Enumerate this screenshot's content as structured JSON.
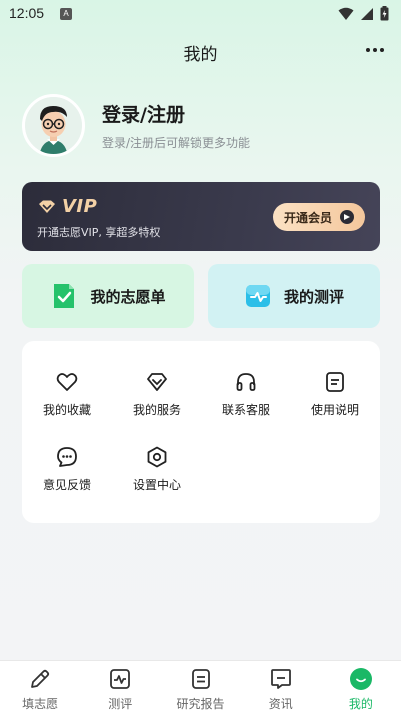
{
  "status_bar": {
    "time": "12:05",
    "notification_letter": "A"
  },
  "header": {
    "title": "我的"
  },
  "profile": {
    "title": "登录/注册",
    "subtitle": "登录/注册后可解锁更多功能"
  },
  "vip": {
    "badge": "VIP",
    "description": "开通志愿VIP, 享超多特权",
    "button_label": "开通会员"
  },
  "quick_actions": [
    {
      "label": "我的志愿单",
      "icon": "checklist-icon"
    },
    {
      "label": "我的测评",
      "icon": "assessment-icon"
    }
  ],
  "tools": [
    {
      "label": "我的收藏",
      "icon": "heart-icon"
    },
    {
      "label": "我的服务",
      "icon": "diamond-icon"
    },
    {
      "label": "联系客服",
      "icon": "headset-icon"
    },
    {
      "label": "使用说明",
      "icon": "document-icon"
    },
    {
      "label": "意见反馈",
      "icon": "feedback-icon"
    },
    {
      "label": "设置中心",
      "icon": "settings-icon"
    }
  ],
  "bottom_nav": [
    {
      "label": "填志愿",
      "icon": "pen-icon"
    },
    {
      "label": "测评",
      "icon": "chart-icon"
    },
    {
      "label": "研究报告",
      "icon": "report-icon"
    },
    {
      "label": "资讯",
      "icon": "news-icon"
    },
    {
      "label": "我的",
      "icon": "profile-icon",
      "active": true
    }
  ],
  "colors": {
    "accent": "#1ab866",
    "vip_gold": "#f3d1a6",
    "vip_bg": "#2c2c3a"
  }
}
